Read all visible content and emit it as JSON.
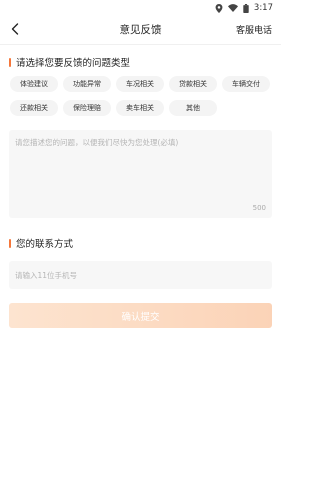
{
  "status": {
    "time": "3:17"
  },
  "nav": {
    "title": "意见反馈",
    "service": "客服电话"
  },
  "section_type": {
    "title": "请选择您要反馈的问题类型"
  },
  "chips": [
    "体验建议",
    "功能异常",
    "车况相关",
    "贷款相关",
    "车辆交付",
    "还款相关",
    "保险理赔",
    "卖车相关",
    "其他"
  ],
  "feedback": {
    "placeholder": "请您描述您的问题，以便我们尽快为您处理(必填)",
    "counter": "500"
  },
  "section_contact": {
    "title": "您的联系方式"
  },
  "phone": {
    "placeholder": "请输入11位手机号"
  },
  "submit": {
    "label": "确认提交"
  },
  "colors": {
    "accent": "#f5773b",
    "submit_disabled": "#fbd9c2"
  }
}
